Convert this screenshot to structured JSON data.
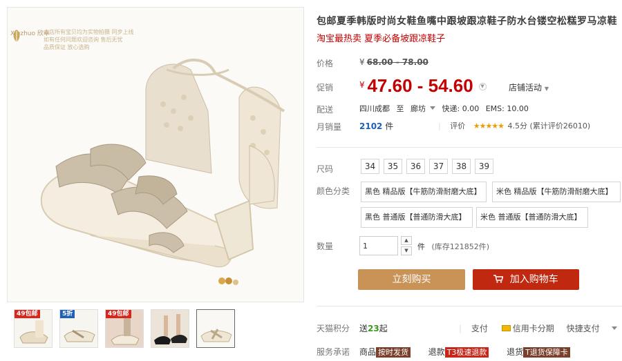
{
  "gallery": {
    "logo_text": "Xinzhuo 欣卓",
    "promo_lines": [
      "本店所有宝贝均为实物拍摄 同步上线",
      "如有任何问题欢迎咨询 售后无忧",
      "品质保证 放心选购"
    ],
    "thumbs": [
      {
        "badge": "49包邮"
      },
      {
        "badge": "5折"
      },
      {
        "badge": "49包邮"
      },
      {
        "badge": ""
      },
      {
        "badge": ""
      }
    ]
  },
  "product": {
    "title": "包邮夏季韩版时尚女鞋鱼嘴中跟坡跟凉鞋子防水台镂空松糕罗马凉鞋",
    "subtitle": "淘宝最热卖 夏季必备坡跟凉鞋子"
  },
  "price": {
    "label": "价格",
    "original": "68.00 - 78.00",
    "currency": "¥",
    "promo_label": "促销",
    "promo": "47.60 - 54.60",
    "store_promo": "店铺活动"
  },
  "shipping": {
    "label": "配送",
    "from": "四川成都",
    "to_word": "至",
    "dest": "廊坊",
    "express": "快递: 0.00",
    "ems": "EMS: 10.00"
  },
  "sales": {
    "label": "月销量",
    "count": "2102",
    "unit": "件",
    "rating_label": "评价",
    "stars": "★★★★★",
    "score": "4.5分",
    "reviews": "(累计评价26010)"
  },
  "size": {
    "label": "尺码",
    "options": [
      "34",
      "35",
      "36",
      "37",
      "38",
      "39"
    ]
  },
  "color": {
    "label": "颜色分类",
    "options": [
      "黑色 精品版【牛筋防滑耐磨大底】",
      "米色 精品版【牛筋防滑耐磨大底】",
      "黑色 普通版【普通防滑大底】",
      "米色 普通版【普通防滑大底】"
    ]
  },
  "quantity": {
    "label": "数量",
    "value": "1",
    "unit": "件",
    "stock": "(库存121852件)"
  },
  "actions": {
    "buy_now": "立刻购买",
    "add_to_cart": "加入购物车"
  },
  "points": {
    "label": "天猫积分",
    "prefix": "送",
    "value": "23",
    "suffix": "起"
  },
  "payment": {
    "label": "支付",
    "card": "信用卡分期",
    "quick": "快捷支付"
  },
  "services": {
    "label": "服务承诺",
    "items": [
      {
        "prefix": "商品",
        "tag": "按时发货"
      },
      {
        "prefix": "退款",
        "tag": "T3极速退款"
      },
      {
        "prefix": "退货",
        "tag": "T退货保障卡"
      }
    ]
  },
  "colors": {
    "price_red": "#c40000",
    "buy_button": "#c99257",
    "cart_button": "#c0280f",
    "link_blue": "#1e5fb8"
  }
}
